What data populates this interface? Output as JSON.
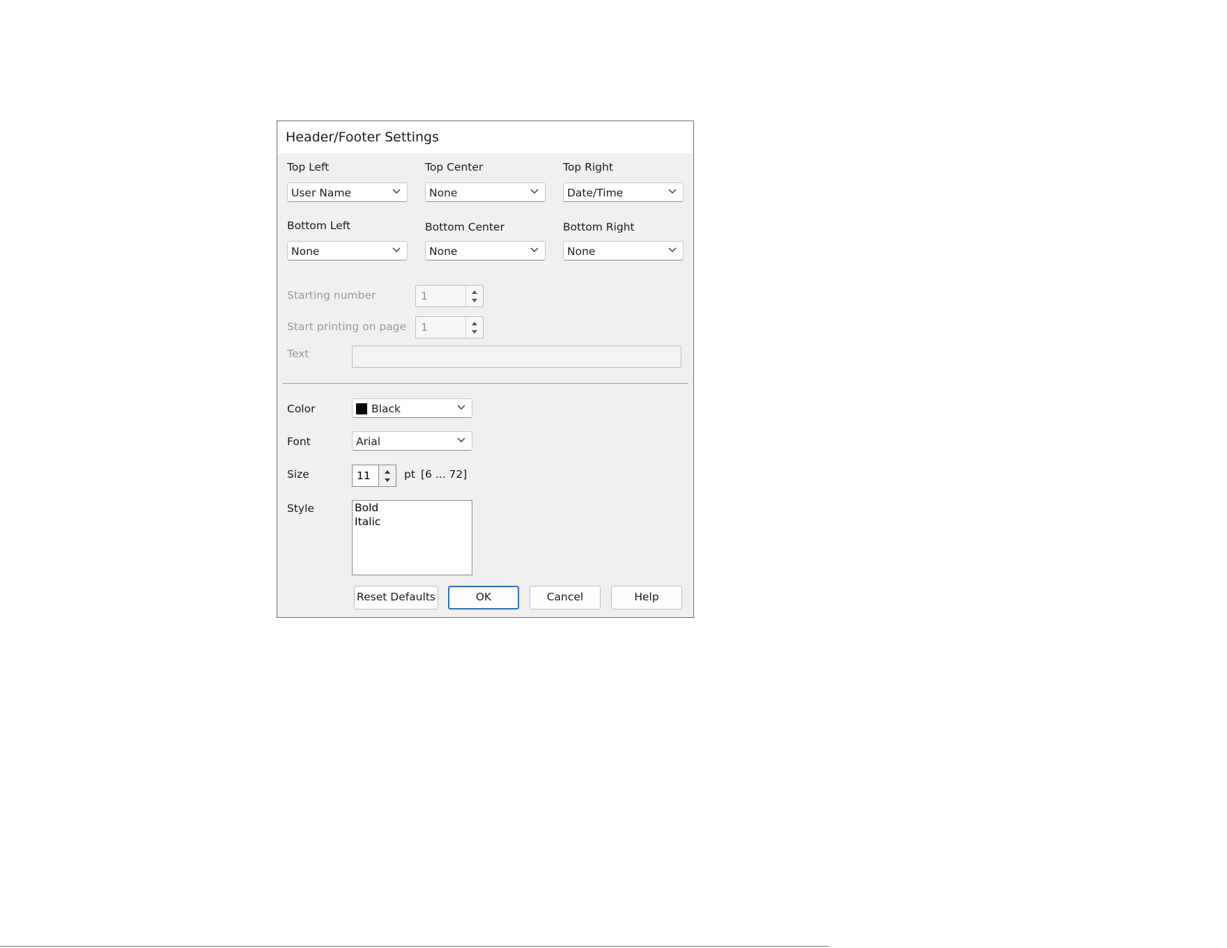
{
  "dialog": {
    "title": "Header/Footer Settings",
    "positions": [
      {
        "label": "Top Left",
        "value": "User Name"
      },
      {
        "label": "Top Center",
        "value": "None"
      },
      {
        "label": "Top Right",
        "value": "Date/Time"
      },
      {
        "label": "Bottom Left",
        "value": "None"
      },
      {
        "label": "Bottom Center",
        "value": "None"
      },
      {
        "label": "Bottom Right",
        "value": "None"
      }
    ],
    "starting_number": {
      "label": "Starting number",
      "value": "1"
    },
    "start_printing": {
      "label": "Start printing on page",
      "value": "1"
    },
    "text": {
      "label": "Text",
      "value": ""
    },
    "color": {
      "label": "Color",
      "value": "Black",
      "swatch": "#000000"
    },
    "font": {
      "label": "Font",
      "value": "Arial"
    },
    "size": {
      "label": "Size",
      "value": "11",
      "unit": "pt",
      "range": "[6 ... 72]"
    },
    "style": {
      "label": "Style",
      "options": [
        "Bold",
        "Italic"
      ]
    },
    "buttons": {
      "reset": "Reset Defaults",
      "ok": "OK",
      "cancel": "Cancel",
      "help": "Help"
    }
  }
}
